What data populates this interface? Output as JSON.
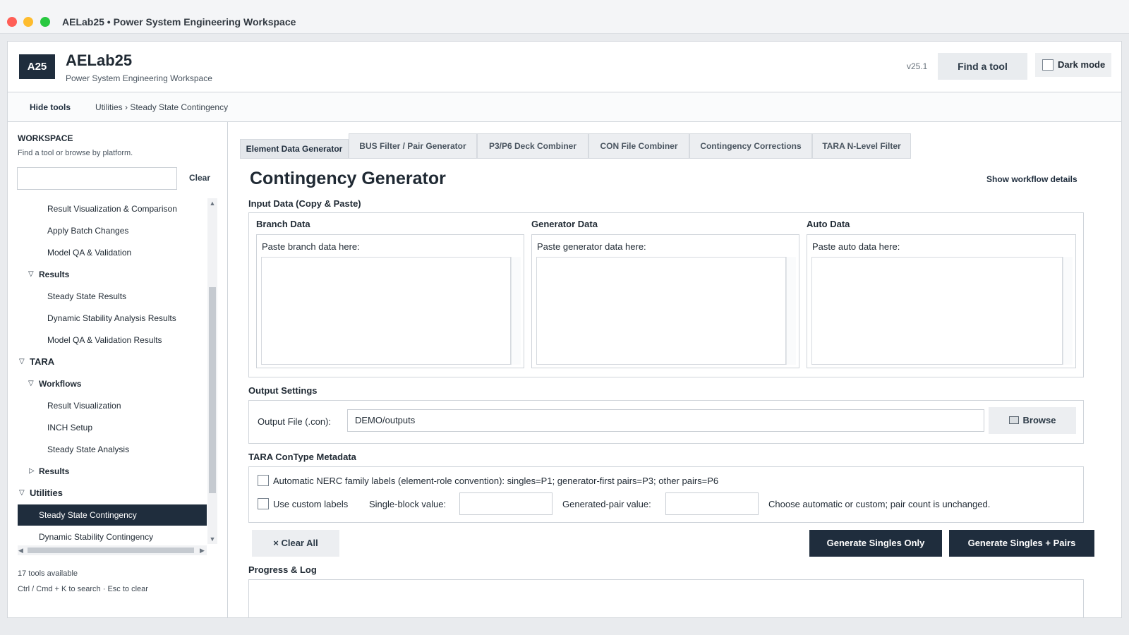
{
  "window": {
    "title": "AELab25 • Power System Engineering Workspace"
  },
  "header": {
    "logo": "A25",
    "app_name": "AELab25",
    "subtitle": "Power System Engineering Workspace",
    "version": "v25.1",
    "find_tool_label": "Find a tool",
    "dark_mode_label": "Dark mode"
  },
  "nav": {
    "hide_tools_label": "Hide tools",
    "breadcrumb": "Utilities › Steady State Contingency"
  },
  "sidebar": {
    "title": "WORKSPACE",
    "subtitle": "Find a tool or browse by platform.",
    "search_value": "",
    "clear_label": "Clear",
    "items": [
      {
        "label": "Result Visualization & Comparison"
      },
      {
        "label": "Apply Batch Changes"
      },
      {
        "label": "Model QA & Validation"
      },
      {
        "label": "Results"
      },
      {
        "label": "Steady State Results"
      },
      {
        "label": "Dynamic Stability Analysis Results"
      },
      {
        "label": "Model QA & Validation Results"
      },
      {
        "label": "TARA"
      },
      {
        "label": "Workflows"
      },
      {
        "label": "Result Visualization"
      },
      {
        "label": "INCH Setup"
      },
      {
        "label": "Steady State Analysis"
      },
      {
        "label": "Results"
      },
      {
        "label": "Utilities"
      },
      {
        "label": "Steady State Contingency"
      },
      {
        "label": "Dynamic Stability Contingency"
      }
    ],
    "tools_count": "17 tools available",
    "shortcut_hint": "Ctrl / Cmd + K to search · Esc to clear"
  },
  "tabs": [
    {
      "label": "Element Data Generator"
    },
    {
      "label": "BUS Filter / Pair Generator"
    },
    {
      "label": "P3/P6 Deck Combiner"
    },
    {
      "label": "CON File Combiner"
    },
    {
      "label": "Contingency Corrections"
    },
    {
      "label": "TARA N-Level Filter"
    }
  ],
  "main": {
    "title": "Contingency Generator",
    "workflow_link": "Show workflow details",
    "input_section": "Input Data (Copy & Paste)",
    "columns": [
      {
        "title": "Branch Data",
        "hint": "Paste branch data here:",
        "value": ""
      },
      {
        "title": "Generator Data",
        "hint": "Paste generator data here:",
        "value": ""
      },
      {
        "title": "Auto Data",
        "hint": "Paste auto data here:",
        "value": ""
      }
    ],
    "output_section": "Output Settings",
    "output_label": "Output File (.con):",
    "output_value": "DEMO/outputs",
    "browse_label": "Browse",
    "metadata_section": "TARA ConType Metadata",
    "auto_labels_text": "Automatic NERC family labels (element-role convention): singles=P1; generator-first pairs=P3; other pairs=P6",
    "custom_labels_text": "Use custom labels",
    "single_block_label": "Single-block value:",
    "single_block_value": "",
    "generated_pair_label": "Generated-pair value:",
    "generated_pair_value": "",
    "choose_hint": "Choose automatic or custom; pair count is unchanged.",
    "clear_all_label": "× Clear All",
    "gen_singles_label": "Generate Singles Only",
    "gen_pairs_label": "Generate Singles + Pairs",
    "progress_section": "Progress & Log"
  }
}
